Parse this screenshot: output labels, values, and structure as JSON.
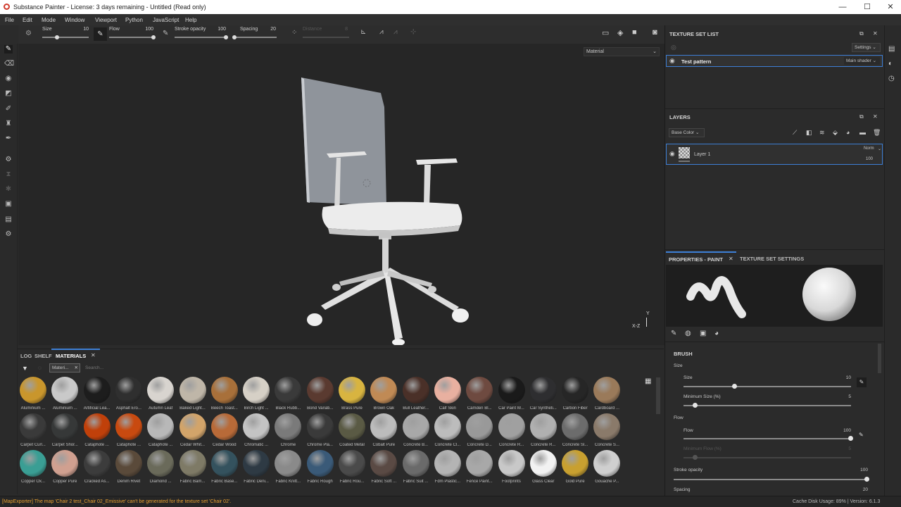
{
  "window": {
    "title": "Substance Painter - License: 3 days remaining - Untitled (Read only)",
    "minimize": "—",
    "maximize": "☐",
    "close": "✕"
  },
  "menu": [
    "File",
    "Edit",
    "Mode",
    "Window",
    "Viewport",
    "Python",
    "JavaScript",
    "Help"
  ],
  "toolbar": {
    "size_label": "Size",
    "size_value": "10",
    "flow_label": "Flow",
    "flow_value": "100",
    "stroke_opacity_label": "Stroke opacity",
    "stroke_opacity_value": "100",
    "spacing_label": "Spacing",
    "spacing_value": "20",
    "distance_label": "Distance",
    "distance_value": "8"
  },
  "viewport": {
    "channel_select": "Material",
    "axis_y": "Y",
    "axis_xz": "X-Z"
  },
  "shelf": {
    "tabs": [
      "LOG",
      "SHELF",
      "MATERIALS"
    ],
    "active_tab": "MATERIALS",
    "filter_chip": "Materi...",
    "search_placeholder": "Search...",
    "materials": [
      {
        "label": "Aluminium ...",
        "color": "#c9962c"
      },
      {
        "label": "Aluminium ...",
        "color": "#c9c9c9"
      },
      {
        "label": "Artificial Lea...",
        "color": "#1d1d1d"
      },
      {
        "label": "Asphalt Ero...",
        "color": "#2f2f2f"
      },
      {
        "label": "Autumn Leaf",
        "color": "#d8d4cf"
      },
      {
        "label": "Baked Light...",
        "color": "#bfb6a8"
      },
      {
        "label": "Beech Toast...",
        "color": "#a8703a"
      },
      {
        "label": "Birch Light ...",
        "color": "#d6d0c6"
      },
      {
        "label": "Black Rubb...",
        "color": "#3a3a3a"
      },
      {
        "label": "Bond Variati...",
        "color": "#5a3a30"
      },
      {
        "label": "Brass Pure",
        "color": "#d8b440"
      },
      {
        "label": "Brown Oak",
        "color": "#c08a55"
      },
      {
        "label": "Bull Leather...",
        "color": "#4a3028"
      },
      {
        "label": "Calf Skin",
        "color": "#e8b0a0"
      },
      {
        "label": "Camden Bl...",
        "color": "#6e4a40"
      },
      {
        "label": "Car Paint M...",
        "color": "#1a1a1a"
      },
      {
        "label": "Car Syntheti...",
        "color": "#2e2e30"
      },
      {
        "label": "Carbon Fiber",
        "color": "#262626"
      },
      {
        "label": "Cardboard ...",
        "color": "#9a7a5a"
      },
      {
        "label": "Carpet Curl...",
        "color": "#3a3a3a"
      },
      {
        "label": "Carpet Shor...",
        "color": "#363838"
      },
      {
        "label": "Cataphote ...",
        "color": "#c0400a"
      },
      {
        "label": "Cataphote ...",
        "color": "#c84a10"
      },
      {
        "label": "Cataphote ...",
        "color": "#b8b8b8"
      },
      {
        "label": "Cedar Whit...",
        "color": "#d2a46a"
      },
      {
        "label": "Cedar Wood",
        "color": "#b86a38"
      },
      {
        "label": "Chromatic ...",
        "color": "#c4c4c4"
      },
      {
        "label": "Chrome",
        "color": "#7a7a7a"
      },
      {
        "label": "Chrome Pla...",
        "color": "#3a3a3a"
      },
      {
        "label": "Coated Metal",
        "color": "#5a5a44"
      },
      {
        "label": "Cobalt Pure",
        "color": "#bcbcbc"
      },
      {
        "label": "Concrete B...",
        "color": "#a8a8a8"
      },
      {
        "label": "Concrete Cl...",
        "color": "#bcbcbc"
      },
      {
        "label": "Concrete D...",
        "color": "#999"
      },
      {
        "label": "Concrete R...",
        "color": "#a0a0a0"
      },
      {
        "label": "Concrete R...",
        "color": "#b0b0b0"
      },
      {
        "label": "Concrete Sl...",
        "color": "#6c6c6c"
      },
      {
        "label": "Concrete S...",
        "color": "#8a7a6a"
      },
      {
        "label": "Copper Ox...",
        "color": "#3a9e94"
      },
      {
        "label": "Copper Pure",
        "color": "#d0a090"
      },
      {
        "label": "Cracked As...",
        "color": "#3c3c3c"
      },
      {
        "label": "Denim Rivet",
        "color": "#5a4a3a"
      },
      {
        "label": "Diamond ...",
        "color": "#6a6a5a"
      },
      {
        "label": "Fabric Bam...",
        "color": "#7e7a66"
      },
      {
        "label": "Fabric Base...",
        "color": "#34525e"
      },
      {
        "label": "Fabric Deni...",
        "color": "#2e3a44"
      },
      {
        "label": "Fabric Knitt...",
        "color": "#8a8a8a"
      },
      {
        "label": "Fabric Rough",
        "color": "#3a5a78"
      },
      {
        "label": "Fabric Rou...",
        "color": "#4a4a4a"
      },
      {
        "label": "Fabric Soft ...",
        "color": "#5a4a44"
      },
      {
        "label": "Fabric Suit ...",
        "color": "#6a6a6a"
      },
      {
        "label": "Fdm Plastic...",
        "color": "#b4b4b4"
      },
      {
        "label": "Fence Paint...",
        "color": "#a8a8a8"
      },
      {
        "label": "Footprints",
        "color": "#c8c8c8"
      },
      {
        "label": "Glass Clear",
        "color": "#f2f2f2"
      },
      {
        "label": "Gold Pure",
        "color": "#c8a030"
      },
      {
        "label": "Gouache P...",
        "color": "#cfcfcf"
      }
    ]
  },
  "status": {
    "message": "[MapExporter] The map 'Chair 2 test_Chair 02_Emissive' can't be generated for the texture set 'Chair 02'.",
    "cache": "Cache Disk Usage:   89% | Version: 6.1.3"
  },
  "texture_set_list": {
    "title": "TEXTURE SET LIST",
    "settings_label": "Settings",
    "set_name": "Test pattern",
    "shader": "Main shader"
  },
  "layers": {
    "title": "LAYERS",
    "channel": "Base Color",
    "layer_name": "Layer 1",
    "blend_mode": "Norm",
    "opacity": "100"
  },
  "properties": {
    "tab_paint": "PROPERTIES - PAINT",
    "tab_texture": "TEXTURE SET SETTINGS",
    "brush_title": "BRUSH",
    "size_group": "Size",
    "size_label": "Size",
    "size_value": "10",
    "size_fraction": 0.3,
    "min_size_label": "Minimum Size (%)",
    "min_size_value": "5",
    "min_size_fraction": 0.05,
    "flow_group": "Flow",
    "flow_label": "Flow",
    "flow_value": "100",
    "flow_fraction": 1.0,
    "min_flow_label": "Minimum Flow (%)",
    "min_flow_value": "5",
    "stroke_opacity_label": "Stroke opacity",
    "stroke_opacity_value": "100",
    "spacing_label": "Spacing",
    "spacing_value": "20"
  }
}
